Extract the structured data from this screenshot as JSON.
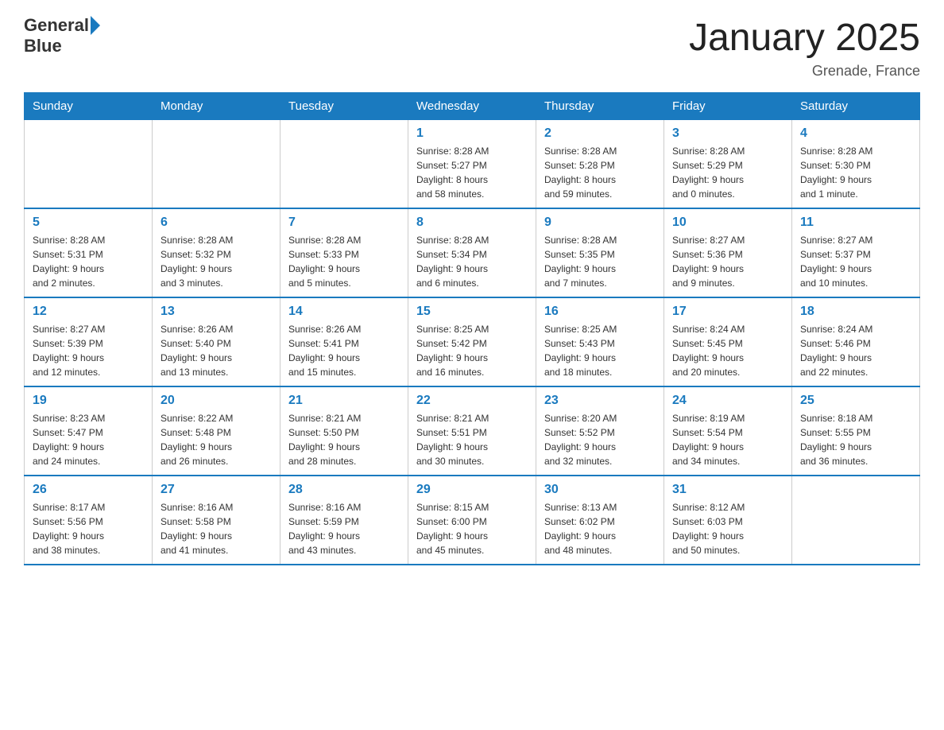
{
  "header": {
    "logo_text_general": "General",
    "logo_text_blue": "Blue",
    "title": "January 2025",
    "subtitle": "Grenade, France"
  },
  "days_of_week": [
    "Sunday",
    "Monday",
    "Tuesday",
    "Wednesday",
    "Thursday",
    "Friday",
    "Saturday"
  ],
  "weeks": [
    [
      {
        "day": "",
        "info": ""
      },
      {
        "day": "",
        "info": ""
      },
      {
        "day": "",
        "info": ""
      },
      {
        "day": "1",
        "info": "Sunrise: 8:28 AM\nSunset: 5:27 PM\nDaylight: 8 hours\nand 58 minutes."
      },
      {
        "day": "2",
        "info": "Sunrise: 8:28 AM\nSunset: 5:28 PM\nDaylight: 8 hours\nand 59 minutes."
      },
      {
        "day": "3",
        "info": "Sunrise: 8:28 AM\nSunset: 5:29 PM\nDaylight: 9 hours\nand 0 minutes."
      },
      {
        "day": "4",
        "info": "Sunrise: 8:28 AM\nSunset: 5:30 PM\nDaylight: 9 hours\nand 1 minute."
      }
    ],
    [
      {
        "day": "5",
        "info": "Sunrise: 8:28 AM\nSunset: 5:31 PM\nDaylight: 9 hours\nand 2 minutes."
      },
      {
        "day": "6",
        "info": "Sunrise: 8:28 AM\nSunset: 5:32 PM\nDaylight: 9 hours\nand 3 minutes."
      },
      {
        "day": "7",
        "info": "Sunrise: 8:28 AM\nSunset: 5:33 PM\nDaylight: 9 hours\nand 5 minutes."
      },
      {
        "day": "8",
        "info": "Sunrise: 8:28 AM\nSunset: 5:34 PM\nDaylight: 9 hours\nand 6 minutes."
      },
      {
        "day": "9",
        "info": "Sunrise: 8:28 AM\nSunset: 5:35 PM\nDaylight: 9 hours\nand 7 minutes."
      },
      {
        "day": "10",
        "info": "Sunrise: 8:27 AM\nSunset: 5:36 PM\nDaylight: 9 hours\nand 9 minutes."
      },
      {
        "day": "11",
        "info": "Sunrise: 8:27 AM\nSunset: 5:37 PM\nDaylight: 9 hours\nand 10 minutes."
      }
    ],
    [
      {
        "day": "12",
        "info": "Sunrise: 8:27 AM\nSunset: 5:39 PM\nDaylight: 9 hours\nand 12 minutes."
      },
      {
        "day": "13",
        "info": "Sunrise: 8:26 AM\nSunset: 5:40 PM\nDaylight: 9 hours\nand 13 minutes."
      },
      {
        "day": "14",
        "info": "Sunrise: 8:26 AM\nSunset: 5:41 PM\nDaylight: 9 hours\nand 15 minutes."
      },
      {
        "day": "15",
        "info": "Sunrise: 8:25 AM\nSunset: 5:42 PM\nDaylight: 9 hours\nand 16 minutes."
      },
      {
        "day": "16",
        "info": "Sunrise: 8:25 AM\nSunset: 5:43 PM\nDaylight: 9 hours\nand 18 minutes."
      },
      {
        "day": "17",
        "info": "Sunrise: 8:24 AM\nSunset: 5:45 PM\nDaylight: 9 hours\nand 20 minutes."
      },
      {
        "day": "18",
        "info": "Sunrise: 8:24 AM\nSunset: 5:46 PM\nDaylight: 9 hours\nand 22 minutes."
      }
    ],
    [
      {
        "day": "19",
        "info": "Sunrise: 8:23 AM\nSunset: 5:47 PM\nDaylight: 9 hours\nand 24 minutes."
      },
      {
        "day": "20",
        "info": "Sunrise: 8:22 AM\nSunset: 5:48 PM\nDaylight: 9 hours\nand 26 minutes."
      },
      {
        "day": "21",
        "info": "Sunrise: 8:21 AM\nSunset: 5:50 PM\nDaylight: 9 hours\nand 28 minutes."
      },
      {
        "day": "22",
        "info": "Sunrise: 8:21 AM\nSunset: 5:51 PM\nDaylight: 9 hours\nand 30 minutes."
      },
      {
        "day": "23",
        "info": "Sunrise: 8:20 AM\nSunset: 5:52 PM\nDaylight: 9 hours\nand 32 minutes."
      },
      {
        "day": "24",
        "info": "Sunrise: 8:19 AM\nSunset: 5:54 PM\nDaylight: 9 hours\nand 34 minutes."
      },
      {
        "day": "25",
        "info": "Sunrise: 8:18 AM\nSunset: 5:55 PM\nDaylight: 9 hours\nand 36 minutes."
      }
    ],
    [
      {
        "day": "26",
        "info": "Sunrise: 8:17 AM\nSunset: 5:56 PM\nDaylight: 9 hours\nand 38 minutes."
      },
      {
        "day": "27",
        "info": "Sunrise: 8:16 AM\nSunset: 5:58 PM\nDaylight: 9 hours\nand 41 minutes."
      },
      {
        "day": "28",
        "info": "Sunrise: 8:16 AM\nSunset: 5:59 PM\nDaylight: 9 hours\nand 43 minutes."
      },
      {
        "day": "29",
        "info": "Sunrise: 8:15 AM\nSunset: 6:00 PM\nDaylight: 9 hours\nand 45 minutes."
      },
      {
        "day": "30",
        "info": "Sunrise: 8:13 AM\nSunset: 6:02 PM\nDaylight: 9 hours\nand 48 minutes."
      },
      {
        "day": "31",
        "info": "Sunrise: 8:12 AM\nSunset: 6:03 PM\nDaylight: 9 hours\nand 50 minutes."
      },
      {
        "day": "",
        "info": ""
      }
    ]
  ]
}
